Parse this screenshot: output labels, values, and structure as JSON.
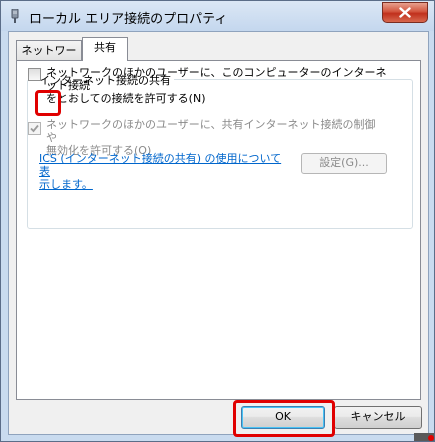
{
  "window": {
    "title": "ローカル エリア接続のプロパティ",
    "close_icon": "close-icon",
    "app_icon": "network-adapter-icon"
  },
  "tabs": [
    {
      "label": "ネットワーク",
      "selected": false
    },
    {
      "label": "共有",
      "selected": true
    }
  ],
  "sharing": {
    "group_title": "インターネット接続の共有",
    "allow_connect": {
      "label": "ネットワークのほかのユーザーに、このコンピューターのインターネット接続\nをとおしての接続を許可する(N)",
      "checked": false,
      "enabled": true
    },
    "allow_control": {
      "label": "ネットワークのほかのユーザーに、共有インターネット接続の制御や\n無効化を許可する(O)",
      "checked": true,
      "enabled": false
    },
    "help_link": "ICS (インターネット接続の共有) の使用について表\n示します。",
    "settings_button": "設定(G)..."
  },
  "buttons": {
    "ok": "OK",
    "cancel": "キャンセル"
  },
  "colors": {
    "highlight": "#e00000",
    "link": "#0066cc",
    "close_button": "#c0301c"
  }
}
